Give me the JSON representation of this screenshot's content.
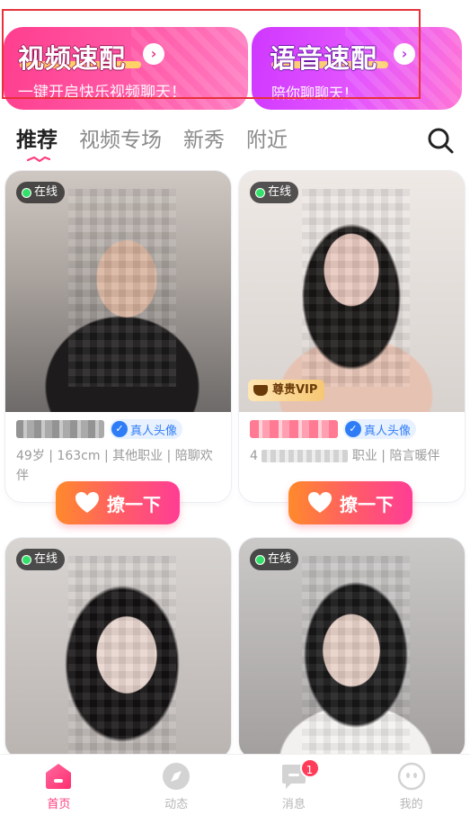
{
  "banners": {
    "video": {
      "title": "视频速配",
      "subtitle": "一键开启快乐视频聊天！",
      "arrow_icon": "chevron-right-icon"
    },
    "voice": {
      "title": "语音速配",
      "subtitle": "陪你聊聊天！",
      "arrow_icon": "chevron-right-icon"
    }
  },
  "tabs": [
    {
      "label": "推荐",
      "active": true
    },
    {
      "label": "视频专场",
      "active": false
    },
    {
      "label": "新秀",
      "active": false
    },
    {
      "label": "附近",
      "active": false
    }
  ],
  "search": {
    "icon": "search-icon"
  },
  "status": {
    "online_label": "在线"
  },
  "cards": [
    {
      "online": true,
      "verified_label": "真人头像",
      "profile_text": "49岁 | 163cm | 其他职业 | 陪聊欢伴",
      "vip": false,
      "flirt_label": "撩一下"
    },
    {
      "online": true,
      "vip": true,
      "vip_label": "尊贵VIP",
      "verified_label": "真人头像",
      "profile_lead": "4",
      "profile_tail": "职业 | 陪言暖伴",
      "flirt_label": "撩一下"
    },
    {
      "online": true
    },
    {
      "online": true
    }
  ],
  "bottom_nav": [
    {
      "label": "首页",
      "icon": "home-icon",
      "active": true
    },
    {
      "label": "动态",
      "icon": "compass-icon",
      "active": false
    },
    {
      "label": "消息",
      "icon": "message-icon",
      "active": false,
      "badge": "1"
    },
    {
      "label": "我的",
      "icon": "profile-face-icon",
      "active": false
    }
  ],
  "colors": {
    "accent": "#ff3d7f",
    "video_banner": "#ff3e8e",
    "voice_banner": "#cf38ff",
    "online_dot": "#35e06a",
    "verified_blue": "#2f7df6"
  }
}
